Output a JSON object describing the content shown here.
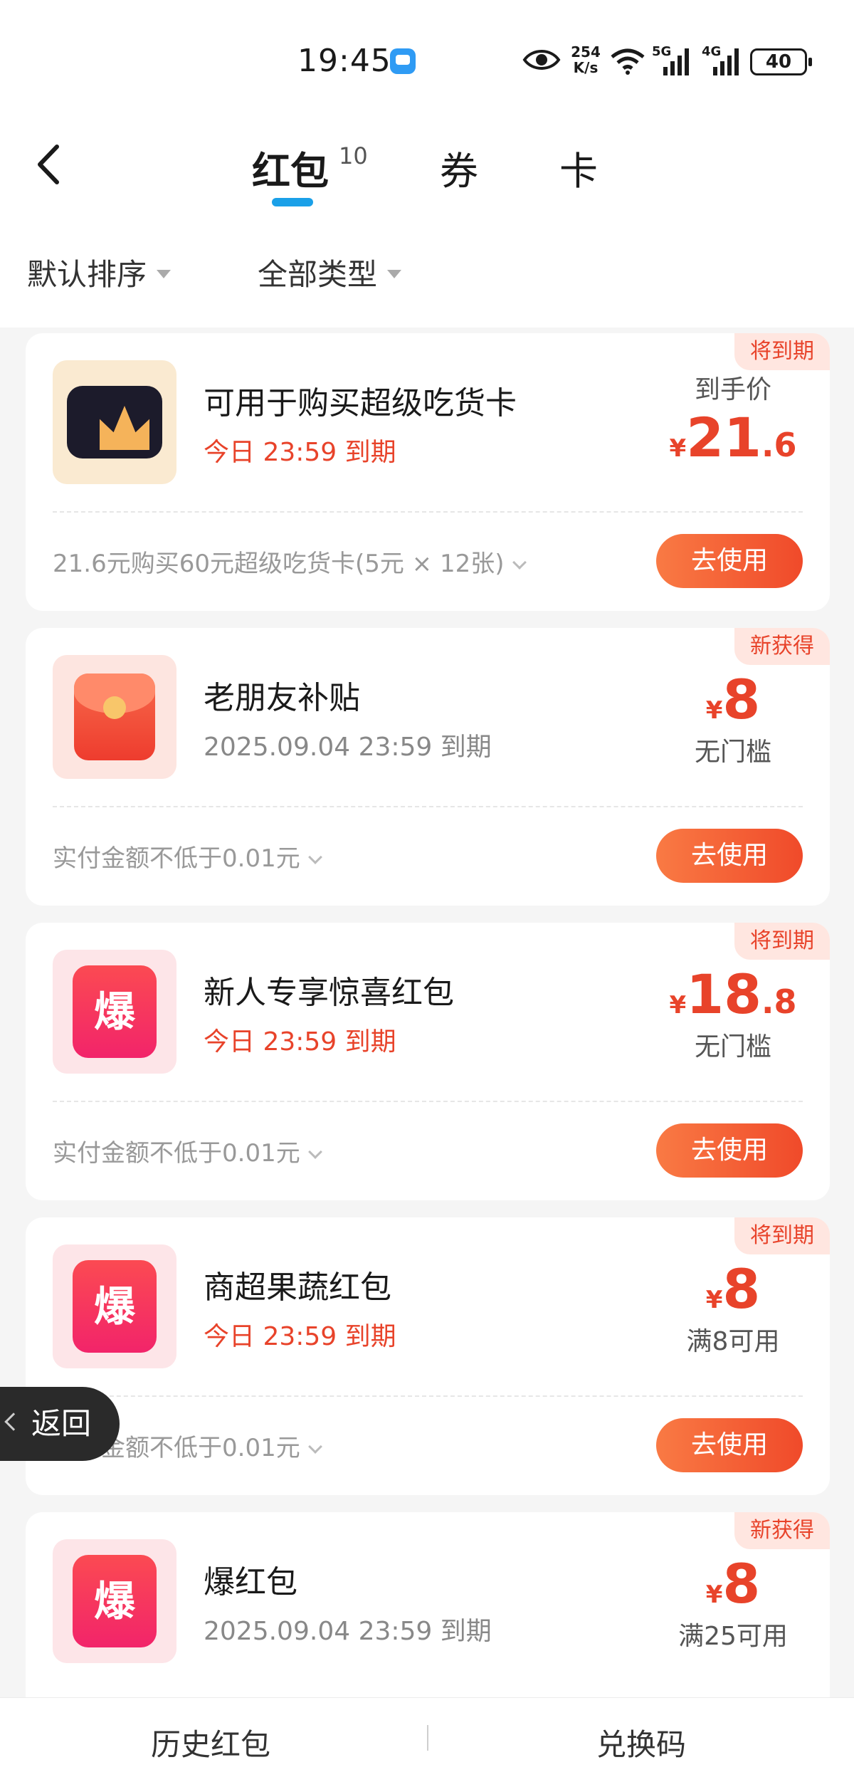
{
  "status_bar": {
    "time": "19:45",
    "net_speed_value": "254",
    "net_speed_unit": "K/s",
    "sig1_label": "5G",
    "sig2_label": "4G",
    "battery": "40"
  },
  "header": {
    "tabs": [
      {
        "label": "红包",
        "count": "10"
      },
      {
        "label": "券"
      },
      {
        "label": "卡"
      }
    ]
  },
  "filters": {
    "sort": "默认排序",
    "type": "全部类型"
  },
  "cards": [
    {
      "tag": "将到期",
      "icon": "crown-card-icon",
      "title": "可用于购买超级吃货卡",
      "expire": "今日 23:59 到期",
      "price_label": "到手价",
      "yen": "¥",
      "price_int": "21",
      "price_dec": ".6",
      "note": "21.6元购买60元超级吃货卡(5元 × 12张)",
      "button": "去使用"
    },
    {
      "tag": "新获得",
      "icon": "red-packet-icon",
      "title": "老朋友补贴",
      "expire": "2025.09.04 23:59 到期",
      "yen": "¥",
      "price_int": "8",
      "price_sub": "无门槛",
      "note": "实付金额不低于0.01元",
      "button": "去使用"
    },
    {
      "tag": "将到期",
      "icon": "bao-icon",
      "icon_text": "爆",
      "title": "新人专享惊喜红包",
      "expire": "今日 23:59 到期",
      "yen": "¥",
      "price_int": "18",
      "price_dec": ".8",
      "price_sub": "无门槛",
      "note": "实付金额不低于0.01元",
      "button": "去使用"
    },
    {
      "tag": "将到期",
      "icon": "bao-icon",
      "icon_text": "爆",
      "title": "商超果蔬红包",
      "expire": "今日 23:59 到期",
      "yen": "¥",
      "price_int": "8",
      "price_sub": "满8可用",
      "note": "实付金额不低于0.01元",
      "button": "去使用"
    },
    {
      "tag": "新获得",
      "icon": "bao-icon",
      "icon_text": "爆",
      "title": "爆红包",
      "expire": "2025.09.04 23:59 到期",
      "yen": "¥",
      "price_int": "8",
      "price_sub": "满25可用"
    }
  ],
  "float_back": {
    "label": "返回"
  },
  "bottom_bar": {
    "history": "历史红包",
    "code": "兑换码"
  },
  "colors": {
    "accent_red": "#e8432a",
    "tab_underline": "#1aa0e8",
    "button_start": "#f97a44",
    "button_end": "#f04a2a"
  }
}
